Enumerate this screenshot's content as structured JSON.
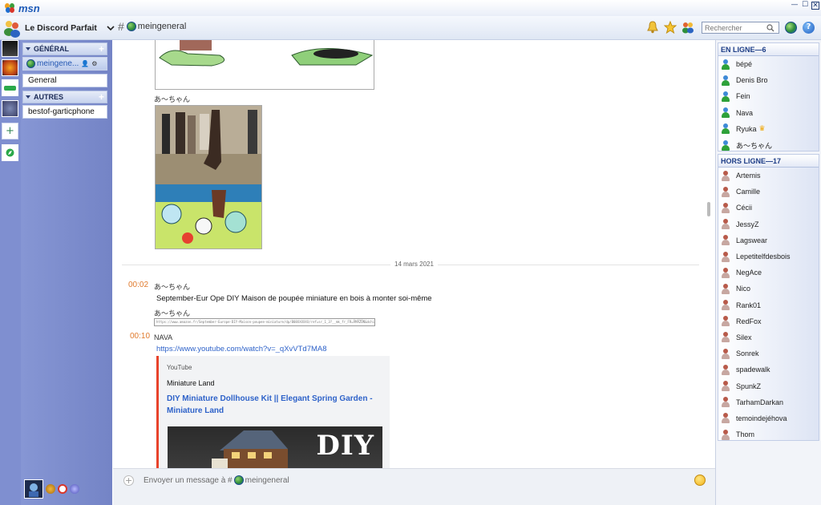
{
  "app": {
    "brand": "msn"
  },
  "window_controls": {
    "minimize": "—",
    "maximize": "☐",
    "close": "✕"
  },
  "header": {
    "server_name": "Le Discord Parfait",
    "channel_prefix": "#",
    "channel_name": "meingeneral",
    "search_placeholder": "Rechercher"
  },
  "sidebar": {
    "categories": [
      {
        "label": "GÉNÉRAL"
      },
      {
        "label": "AUTRES"
      }
    ],
    "channels": [
      {
        "label": "meingene..."
      },
      {
        "label": "General"
      },
      {
        "label": "bestof-garticphone"
      }
    ]
  },
  "chat": {
    "image_caption_user": "あ〜ちゃん",
    "date_divider": "14 mars 2021",
    "messages": [
      {
        "time": "00:02",
        "user": "あ〜ちゃん",
        "text": "September-Eur Ope DIY Maison de poupée miniature en bois à monter soi-même"
      },
      {
        "user": "あ〜ちゃん",
        "link": "https://www.amazon.fr/September-Europe-DIY-Maison-poupee-miniature/dp/B08XXXXXX/ref=sr_1_3?__mk_fr_FR=ÅMÅŽÕÑ&dchild=1&keywords=maison+poupee+miniature"
      },
      {
        "time": "00:10",
        "user": "NAVA",
        "link": "https://www.youtube.com/watch?v=_qXvVTd7MA8"
      }
    ],
    "embed": {
      "provider": "YouTube",
      "author": "Miniature Land",
      "title": "DIY Miniature Dollhouse Kit || Elegant Spring Garden - Miniature Land",
      "thumb_text": "DIY"
    }
  },
  "composer": {
    "placeholder_prefix": "Envoyer un message à #",
    "placeholder_channel": "meingeneral"
  },
  "members": {
    "online_header": "EN LIGNE—6",
    "online": [
      "bépé",
      "Denis Bro",
      "Fein",
      "Nava",
      "Ryuka",
      "あ〜ちゃん"
    ],
    "offline_header": "HORS LIGNE—17",
    "offline": [
      "Artemis",
      "Camille",
      "Cécii",
      "JessyZ",
      "Lagswear",
      "Lepetitelfdesbois",
      "NegAce",
      "Nico",
      "Rank01",
      "RedFox",
      "Silex",
      "Sonrek",
      "spadewalk",
      "SpunkZ",
      "TarhamDarkan",
      "temoindejéhova",
      "Thom"
    ]
  },
  "colors": {
    "accent_blue": "#2e62c9",
    "time_orange": "#e07a2d",
    "sidebar_blue": "#7f8fd0",
    "embed_bar": "#e8432b"
  }
}
